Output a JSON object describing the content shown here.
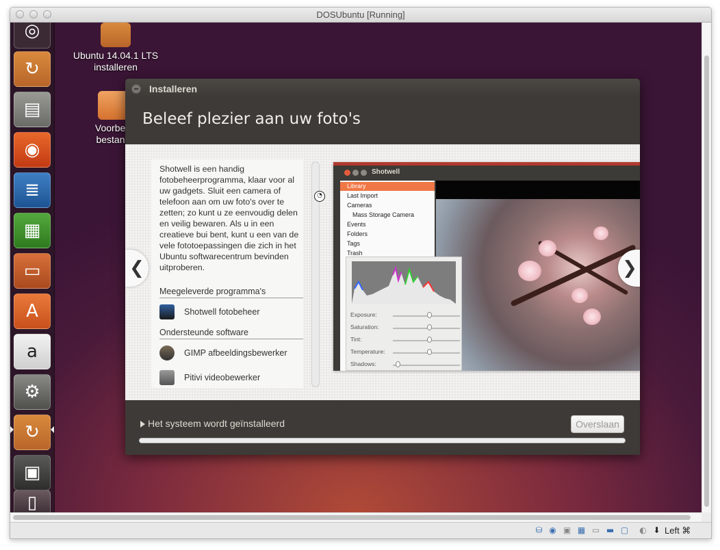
{
  "window": {
    "title": "DOSUbuntu [Running]"
  },
  "desktop": {
    "icons": [
      {
        "label_line1": "Ubuntu 14.04.1 LTS",
        "label_line2": "installeren"
      },
      {
        "label_line1": "Voorbee",
        "label_line2": "bestanc"
      }
    ]
  },
  "launcher": {
    "items": [
      {
        "name": "ubuntu-logo-icon",
        "glyph": "◎"
      },
      {
        "name": "installer-icon",
        "glyph": "↻"
      },
      {
        "name": "files-icon",
        "glyph": "▤"
      },
      {
        "name": "firefox-icon",
        "glyph": "◉"
      },
      {
        "name": "writer-icon",
        "glyph": "≣"
      },
      {
        "name": "calc-icon",
        "glyph": "▦"
      },
      {
        "name": "impress-icon",
        "glyph": "▭"
      },
      {
        "name": "software-center-icon",
        "glyph": "A"
      },
      {
        "name": "amazon-icon",
        "glyph": "a"
      },
      {
        "name": "settings-icon",
        "glyph": "⚙"
      },
      {
        "name": "installer-active-icon",
        "glyph": "↻"
      },
      {
        "name": "floppy-icon",
        "glyph": "▣"
      },
      {
        "name": "trash-icon",
        "glyph": "▯"
      }
    ]
  },
  "dialog": {
    "title": "Installeren",
    "heading": "Beleef plezier aan uw foto's",
    "description": "Shotwell is een handig fotobeheerprogramma, klaar voor al uw gadgets. Sluit een camera of telefoon aan om uw foto's over te zetten; zo kunt u ze eenvoudig delen en veilig bewaren. Als u in een creatieve bui bent, kunt u een van de vele fototoepassingen die zich in het Ubuntu softwarecentrum bevinden uitproberen.",
    "included_heading": "Meegeleverde programma's",
    "included_apps": [
      {
        "label": "Shotwell fotobeheer"
      }
    ],
    "supported_heading": "Ondersteunde software",
    "supported_apps": [
      {
        "label": "GIMP afbeeldingsbewerker"
      },
      {
        "label": "Pitivi videobewerker"
      }
    ],
    "nav_prev": "❮",
    "nav_next": "❯",
    "status_text": "Het systeem wordt geïnstalleerd",
    "skip_button": "Overslaan",
    "progress": 1.0
  },
  "screenshot": {
    "app_title": "Shotwell",
    "sidebar": [
      {
        "label": "Library",
        "selected": true
      },
      {
        "label": "Last Import"
      },
      {
        "label": "Cameras"
      },
      {
        "label": "Mass Storage Camera"
      },
      {
        "label": "Events"
      },
      {
        "label": "Folders"
      },
      {
        "label": "Tags"
      },
      {
        "label": "Trash"
      }
    ],
    "adjustments": [
      {
        "label": "Exposure:",
        "level": 0.55
      },
      {
        "label": "Saturation:",
        "level": 0.55
      },
      {
        "label": "Tint:",
        "level": 0.55
      },
      {
        "label": "Temperature:",
        "level": 0.55
      },
      {
        "label": "Shadows:",
        "level": 0.1
      }
    ]
  },
  "statusbar": {
    "host_key": "Left ⌘"
  },
  "colors": {
    "accent": "#f07746",
    "launcher_bg": "#2b1725",
    "dialog_bg": "#3e3a37"
  }
}
